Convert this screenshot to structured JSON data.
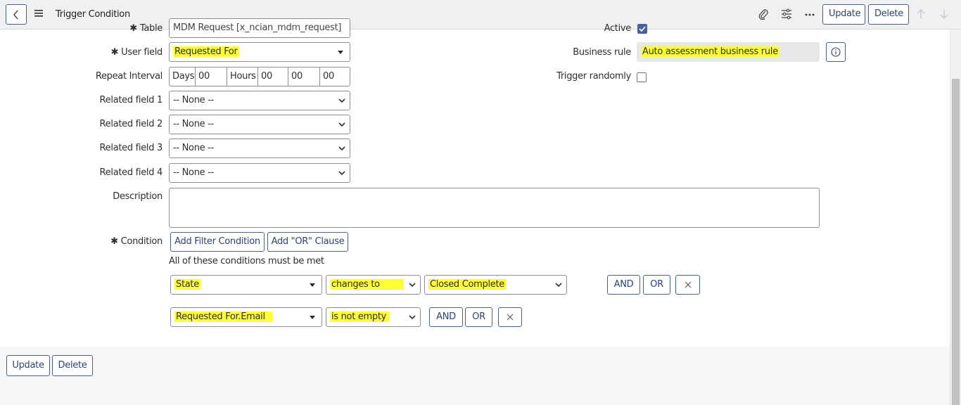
{
  "header": {
    "title": "Trigger Condition",
    "update_label": "Update",
    "delete_label": "Delete"
  },
  "form": {
    "table": {
      "label": "Table",
      "value": "MDM Request [x_ncian_mdm_request]"
    },
    "active": {
      "label": "Active",
      "checked": true
    },
    "user_field": {
      "label": "User field",
      "value": "Requested For"
    },
    "business_rule": {
      "label": "Business rule",
      "value": "Auto assessment business rule"
    },
    "repeat_interval": {
      "label": "Repeat Interval",
      "days_label": "Days",
      "days": "00",
      "hours_label": "Hours",
      "hours": "00",
      "minutes": "00",
      "seconds": "00"
    },
    "trigger_randomly": {
      "label": "Trigger randomly",
      "checked": false
    },
    "related_fields": [
      {
        "label": "Related field 1",
        "value": "-- None --"
      },
      {
        "label": "Related field 2",
        "value": "-- None --"
      },
      {
        "label": "Related field 3",
        "value": "-- None --"
      },
      {
        "label": "Related field 4",
        "value": "-- None --"
      }
    ],
    "description": {
      "label": "Description",
      "value": ""
    },
    "condition": {
      "label": "Condition",
      "add_filter_label": "Add Filter Condition",
      "add_or_label": "Add \"OR\" Clause",
      "summary": "All of these conditions must be met",
      "rows": [
        {
          "field": "State",
          "operator": "changes to",
          "value": "Closed Complete",
          "and": "AND",
          "or": "OR"
        },
        {
          "field": "Requested For.Email",
          "operator": "is not empty",
          "and": "AND",
          "or": "OR"
        }
      ]
    }
  },
  "footer": {
    "update_label": "Update",
    "delete_label": "Delete"
  },
  "colors": {
    "accent": "#2f4274",
    "highlight": "#ffff38",
    "checkbox_checked": "#4d5f9e"
  },
  "icons": [
    "back-icon",
    "menu-icon",
    "paperclip-icon",
    "settings-icon",
    "more-icon",
    "arrow-up-icon",
    "arrow-down-icon",
    "info-icon",
    "close-icon",
    "chevron-down-icon"
  ]
}
